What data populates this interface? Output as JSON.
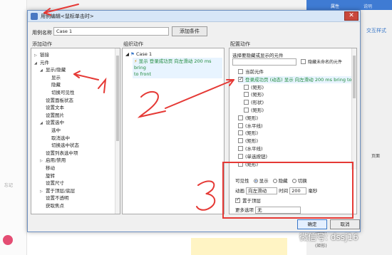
{
  "background": {
    "left_label": "忘记",
    "right_tabs": [
      "属性",
      "说明"
    ],
    "right_link": "交互样式",
    "right_page_label": "页面",
    "right_rows": [
      "(矩形)",
      "(矩形)"
    ]
  },
  "dialog": {
    "title": "用例编辑<鼠标单击时>",
    "case_name_label": "用例名称",
    "case_name_value": "Case 1",
    "add_condition": "添加条件",
    "col_add_action": "添加动作",
    "col_organize": "组织动作",
    "col_configure": "配置动作"
  },
  "actions_tree": [
    {
      "label": "链接",
      "indent": 0,
      "tri": "▷"
    },
    {
      "label": "元件",
      "indent": 0,
      "tri": "◢"
    },
    {
      "label": "显示/隐藏",
      "indent": 1,
      "tri": "◢"
    },
    {
      "label": "显示",
      "indent": 2,
      "tri": ""
    },
    {
      "label": "隐藏",
      "indent": 2,
      "tri": ""
    },
    {
      "label": "切换可见性",
      "indent": 2,
      "tri": ""
    },
    {
      "label": "设置面板状态",
      "indent": 1,
      "tri": ""
    },
    {
      "label": "设置文本",
      "indent": 1,
      "tri": ""
    },
    {
      "label": "设置图片",
      "indent": 1,
      "tri": ""
    },
    {
      "label": "设置选中",
      "indent": 1,
      "tri": "◢"
    },
    {
      "label": "选中",
      "indent": 2,
      "tri": ""
    },
    {
      "label": "取消选中",
      "indent": 2,
      "tri": ""
    },
    {
      "label": "切换选中状态",
      "indent": 2,
      "tri": ""
    },
    {
      "label": "设置列表选中项",
      "indent": 1,
      "tri": ""
    },
    {
      "label": "启用/禁用",
      "indent": 1,
      "tri": "▷"
    },
    {
      "label": "移动",
      "indent": 1,
      "tri": ""
    },
    {
      "label": "旋转",
      "indent": 1,
      "tri": ""
    },
    {
      "label": "设置尺寸",
      "indent": 1,
      "tri": ""
    },
    {
      "label": "置于顶层/底层",
      "indent": 1,
      "tri": "▷"
    },
    {
      "label": "设置不透明",
      "indent": 1,
      "tri": ""
    },
    {
      "label": "获取焦点",
      "indent": 1,
      "tri": ""
    }
  ],
  "organize": {
    "case": "Case 1",
    "action_line1": "显示 登录成功页 向左滑动 200 ms bring",
    "action_line2": "to front"
  },
  "configure": {
    "select_title": "选择要隐藏或显示的元件",
    "hide_unnamed": "隐藏未命名的元件",
    "elements": [
      {
        "label": "当前元件",
        "checked": false,
        "indent": 0
      },
      {
        "label": "登录成功页 (动态) 显示 向左滑动 200 ms bring to front",
        "checked": true,
        "indent": 0
      },
      {
        "label": "(矩形)",
        "checked": false,
        "indent": 1
      },
      {
        "label": "(矩形)",
        "checked": false,
        "indent": 1
      },
      {
        "label": "(形状)",
        "checked": false,
        "indent": 1
      },
      {
        "label": "(矩形)",
        "checked": false,
        "indent": 1
      },
      {
        "label": "(矩形)",
        "checked": false,
        "indent": 0
      },
      {
        "label": "(水平线)",
        "checked": false,
        "indent": 0
      },
      {
        "label": "(矩形)",
        "checked": false,
        "indent": 0
      },
      {
        "label": "(矩形)",
        "checked": false,
        "indent": 0
      },
      {
        "label": "(水平线)",
        "checked": false,
        "indent": 0
      },
      {
        "label": "(单选按钮)",
        "checked": false,
        "indent": 0
      },
      {
        "label": "(矩形)",
        "checked": false,
        "indent": 0
      }
    ],
    "visibility_label": "可见性",
    "vis_options": [
      "显示",
      "隐藏",
      "切换"
    ],
    "anim_label": "动画",
    "anim_value": "向左滑动",
    "time_label": "时间",
    "time_value": "200",
    "ms_label": "毫秒",
    "bring_front": "置于顶层",
    "more_label": "更多选项",
    "more_value": "无"
  },
  "buttons": {
    "ok": "确定",
    "cancel": "取消"
  },
  "annotations": {
    "one": "1",
    "two": "2",
    "three": "3"
  },
  "watermark": "微信号: dssj16",
  "colors": {
    "red": "#e53935",
    "green": "#1f8a3b",
    "accent": "#3a78c9"
  }
}
